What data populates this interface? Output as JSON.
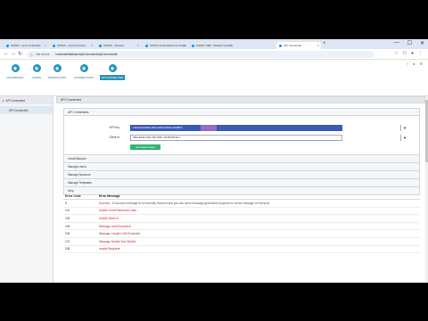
{
  "browser": {
    "tabs": [
      {
        "label": "SIGNiX - Account Details"
      },
      {
        "label": "SIGNiX - Account Setup"
      },
      {
        "label": "SIGNiX - Session"
      },
      {
        "label": "SIGNiX Audit Reference Guide"
      },
      {
        "label": "SIGNiX SEP - Related Content"
      },
      {
        "label": "API Connected"
      }
    ],
    "new_tab": "+",
    "window_controls": [
      "—",
      "☐",
      "✕"
    ],
    "nav": {
      "back": "←",
      "forward": "→",
      "reload": "↻"
    },
    "address": {
      "security_label": "Not secure",
      "url": "localhost/trialbase/ApiConnected/ApiConnected#"
    }
  },
  "app_toolbar": {
    "buttons": [
      {
        "label": "DASHBOARD",
        "icon": "dashboard-icon",
        "glyph": "◉"
      },
      {
        "label": "ADMIN",
        "icon": "admin-icon",
        "glyph": "◉"
      },
      {
        "label": "WORKFLOWS",
        "icon": "workflows-icon",
        "glyph": "◉"
      },
      {
        "label": "CONNECTIONS",
        "icon": "connections-icon",
        "glyph": "◉"
      },
      {
        "label": "API CONNECTED",
        "icon": "api-connected-icon",
        "glyph": "◉",
        "active": true
      }
    ]
  },
  "sidebar": {
    "header": "API Connected",
    "items": [
      {
        "label": "API Connected"
      }
    ]
  },
  "main": {
    "panel_title": "API Connected",
    "accordion": {
      "open_section": "API Credentials",
      "fields": {
        "api_key_label": "API Key",
        "api_key_value": "c1b7ba1da8a4-fa5d-3d9b-f5aa5-4ab880b",
        "client_id_label": "Client Id",
        "client_id_value": "38de48da-f4c6-4f2f-8b51-2d4fd3f5c9e1"
      },
      "generate_button": "Get Access Token",
      "closed_sections": [
        "Credit Balance",
        "Manage Users",
        "Manage Sessions",
        "Manage Templates",
        "Help"
      ]
    },
    "error_table": {
      "col_code": "Error Code",
      "col_message": "Error Message",
      "rows": [
        {
          "code": "0",
          "message": "Success",
          "desc": " - A Success message is not formally returned and you can move message generation response to check message to everyone"
        },
        {
          "code": "101",
          "message": "Invalid Credit Reference Data"
        },
        {
          "code": "103",
          "message": "Invalid Client Id"
        },
        {
          "code": "105",
          "message": "Message Limit Exceeded"
        },
        {
          "code": "106",
          "message": "Message Length Limit Exceeded"
        },
        {
          "code": "107",
          "message": "Message Sender Not Verified"
        },
        {
          "code": "108",
          "message": "Invalid Recipient"
        }
      ]
    }
  },
  "colors": {
    "accent": "#2596be",
    "selection": "#3b5bb8",
    "highlight": "#b078c8",
    "button_green": "#2bb673",
    "error_text": "#c62828"
  }
}
